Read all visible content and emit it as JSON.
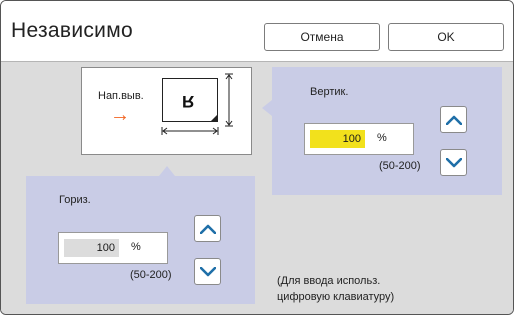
{
  "dialog": {
    "title": "Независимо",
    "cancel_label": "Отмена",
    "ok_label": "OK"
  },
  "diagram": {
    "direction_label": "Нап.выв.",
    "arrow_glyph": "→",
    "sheet_letter": "R"
  },
  "vertical": {
    "label": "Вертик.",
    "value": "100",
    "unit": "%",
    "range": "(50-200)"
  },
  "horizontal": {
    "label": "Гориз.",
    "value": "100",
    "unit": "%",
    "range": "(50-200)"
  },
  "hint": {
    "line1": "(Для ввода использ.",
    "line2": "цифровую клавиатуру)"
  },
  "icons": {
    "up": "chevron-up-icon",
    "down": "chevron-down-icon"
  },
  "colors": {
    "panel": "#c9cce6",
    "background": "#dcdcdc",
    "active_field": "#f2e11c",
    "arrow": "#f26522",
    "chevron": "#1f6fa8"
  }
}
